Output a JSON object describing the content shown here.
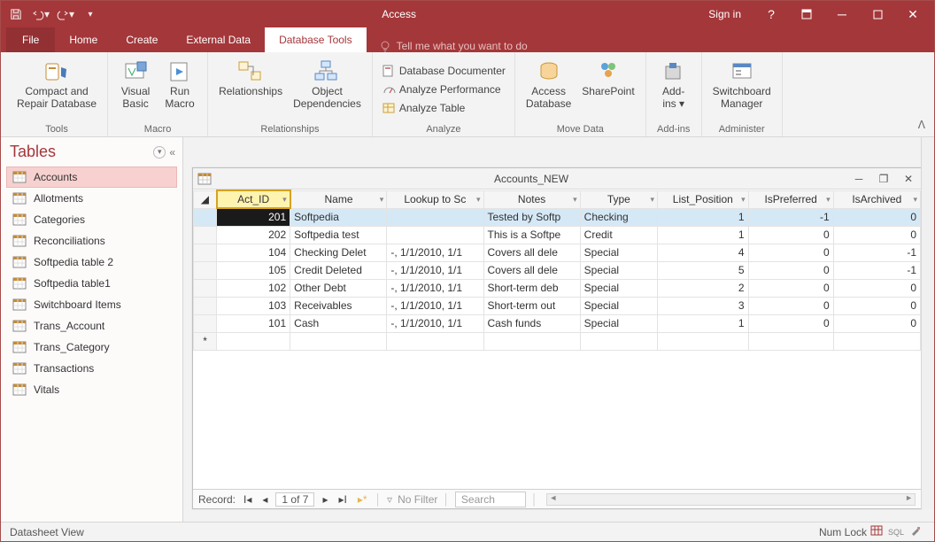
{
  "title": "Access",
  "signin": "Sign in",
  "tabs": {
    "file": "File",
    "home": "Home",
    "create": "Create",
    "external": "External Data",
    "dbtools": "Database Tools",
    "tellme": "Tell me what you want to do"
  },
  "ribbon": {
    "tools": {
      "compact": "Compact and\nRepair Database",
      "label": "Tools"
    },
    "macro": {
      "vb": "Visual\nBasic",
      "run": "Run\nMacro",
      "label": "Macro"
    },
    "relationships": {
      "rel": "Relationships",
      "obj": "Object\nDependencies",
      "label": "Relationships"
    },
    "analyze": {
      "doc": "Database Documenter",
      "perf": "Analyze Performance",
      "tbl": "Analyze Table",
      "label": "Analyze"
    },
    "move": {
      "access": "Access\nDatabase",
      "sp": "SharePoint",
      "label": "Move Data"
    },
    "addins": {
      "btn": "Add-\nins ▾",
      "label": "Add-ins"
    },
    "admin": {
      "sb": "Switchboard\nManager",
      "label": "Administer"
    }
  },
  "nav": {
    "header": "Tables",
    "items": [
      "Accounts",
      "Allotments",
      "Categories",
      "Reconciliations",
      "Softpedia table 2",
      "Softpedia table1",
      "Switchboard Items",
      "Trans_Account",
      "Trans_Category",
      "Transactions",
      "Vitals"
    ]
  },
  "datasheet": {
    "title": "Accounts_NEW",
    "columns": [
      "Act_ID",
      "Name",
      "Lookup to Sc",
      "Notes",
      "Type",
      "List_Position",
      "IsPreferred",
      "IsArchived"
    ],
    "rows": [
      {
        "id": "201",
        "name": "Softpedia",
        "lookup": "",
        "notes": "Tested by Softp",
        "type": "Checking",
        "pos": "1",
        "pref": "-1",
        "arch": "0",
        "sel": true
      },
      {
        "id": "202",
        "name": "Softpedia test",
        "lookup": "",
        "notes": "This is a Softpe",
        "type": "Credit",
        "pos": "1",
        "pref": "0",
        "arch": "0"
      },
      {
        "id": "104",
        "name": "Checking Delet",
        "lookup": "-, 1/1/2010, 1/1",
        "notes": "Covers all dele",
        "type": "Special",
        "pos": "4",
        "pref": "0",
        "arch": "-1"
      },
      {
        "id": "105",
        "name": "Credit Deleted",
        "lookup": "-, 1/1/2010, 1/1",
        "notes": "Covers all dele",
        "type": "Special",
        "pos": "5",
        "pref": "0",
        "arch": "-1"
      },
      {
        "id": "102",
        "name": "Other Debt",
        "lookup": "-, 1/1/2010, 1/1",
        "notes": "Short-term deb",
        "type": "Special",
        "pos": "2",
        "pref": "0",
        "arch": "0"
      },
      {
        "id": "103",
        "name": "Receivables",
        "lookup": "-, 1/1/2010, 1/1",
        "notes": "Short-term out",
        "type": "Special",
        "pos": "3",
        "pref": "0",
        "arch": "0"
      },
      {
        "id": "101",
        "name": "Cash",
        "lookup": "-, 1/1/2010, 1/1",
        "notes": "Cash funds",
        "type": "Special",
        "pos": "1",
        "pref": "0",
        "arch": "0"
      }
    ],
    "recnav": {
      "label": "Record:",
      "pos": "1 of 7",
      "filter": "No Filter",
      "search": "Search"
    }
  },
  "status": {
    "view": "Datasheet View",
    "numlock": "Num Lock"
  }
}
